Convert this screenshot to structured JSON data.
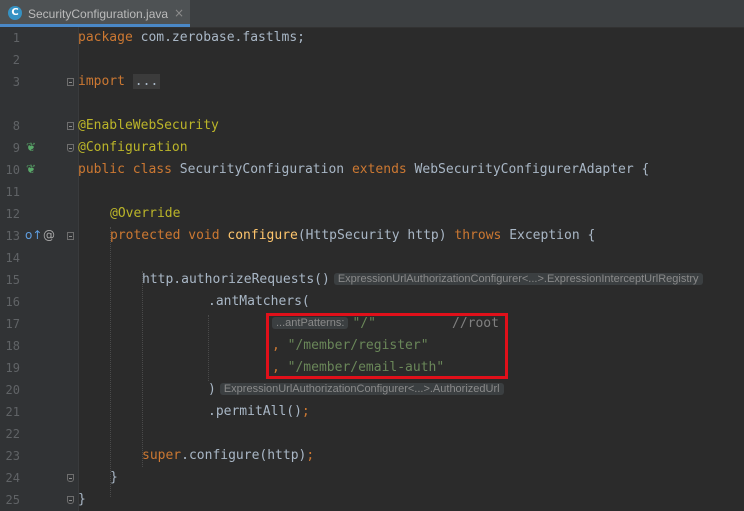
{
  "tab": {
    "icon": "C",
    "filename": "SecurityConfiguration.java",
    "close": "×"
  },
  "lines": [
    {
      "n": "1"
    },
    {
      "n": "2"
    },
    {
      "n": "3"
    },
    {
      "n": "8"
    },
    {
      "n": "9"
    },
    {
      "n": "10"
    },
    {
      "n": "11"
    },
    {
      "n": "12"
    },
    {
      "n": "13"
    },
    {
      "n": "14"
    },
    {
      "n": "15"
    },
    {
      "n": "16"
    },
    {
      "n": "17"
    },
    {
      "n": "18"
    },
    {
      "n": "19"
    },
    {
      "n": "20"
    },
    {
      "n": "21"
    },
    {
      "n": "22"
    },
    {
      "n": "23"
    },
    {
      "n": "24"
    },
    {
      "n": "25"
    }
  ],
  "code": {
    "l1_kw": "package",
    "l1_rest": " com.zerobase.fastlms;",
    "l3_kw": "import",
    "l3_fold": "...",
    "l8": "@EnableWebSecurity",
    "l9": "@Configuration",
    "l10_kw1": "public class",
    "l10_name": " SecurityConfiguration ",
    "l10_kw2": "extends",
    "l10_rest": " WebSecurityConfigurerAdapter {",
    "l12": "@Override",
    "l13_kw": "protected void",
    "l13_fn": " configure",
    "l13_mid": "(HttpSecurity http) ",
    "l13_kw2": "throws",
    "l13_rest": " Exception {",
    "l15": "http.authorizeRequests()",
    "l15_hint": "ExpressionUrlAuthorizationConfigurer<...>.ExpressionInterceptUrlRegistry",
    "l16": ".antMatchers(",
    "l17_hint": "...antPatterns:",
    "l17_str": "\"/\"",
    "l17_cmt": "//root",
    "l18_comma": ", ",
    "l18_str": "\"/member/register\"",
    "l19_comma": ", ",
    "l19_str": "\"/member/email-auth\"",
    "l20": ")",
    "l20_hint": "ExpressionUrlAuthorizationConfigurer<...>.AuthorizedUrl",
    "l21": ".permitAll()",
    "l21_semi": ";",
    "l23_kw": "super",
    "l23_rest": ".configure(http)",
    "l23_semi": ";",
    "l24": "}",
    "l25": "}"
  },
  "gutter_icons": {
    "l9": "bean-icon",
    "l10": "bean-class-icon",
    "l13_a": "override-icon",
    "l13_b": "@"
  },
  "colors": {
    "background": "#2b2b2b",
    "keyword": "#cc7832",
    "annotation": "#bbb529",
    "string": "#6a8759",
    "comment": "#808080",
    "method": "#ffc66d",
    "text": "#a9b7c6",
    "highlight_box": "#e0101a"
  }
}
